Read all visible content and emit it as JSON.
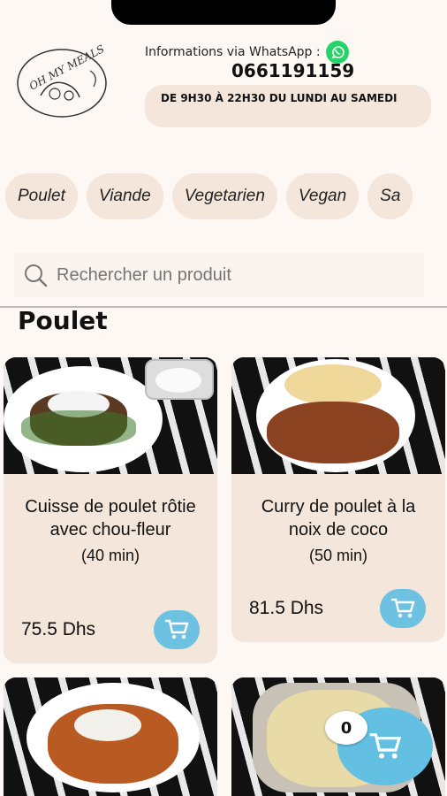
{
  "header": {
    "whatsapp_label": "Informations via WhatsApp :",
    "phone": "0661191159",
    "hours": "DE 9H30 À 22H30 DU LUNDI AU SAMEDI",
    "logo_text": "OH MY MEALS"
  },
  "categories": [
    "Poulet",
    "Viande",
    "Vegetarien",
    "Vegan",
    "Sa"
  ],
  "search": {
    "placeholder": "Rechercher un produit"
  },
  "section": {
    "title": "Poulet"
  },
  "products": [
    {
      "name": "Cuisse de poulet rôtie avec chou-fleur",
      "time": "(40 min)",
      "price": "75.5 Dhs"
    },
    {
      "name": "Curry de poulet à la noix de coco",
      "time": "(50 min)",
      "price": "81.5 Dhs"
    }
  ],
  "cart": {
    "count": "0"
  },
  "colors": {
    "accent": "#63c0e2",
    "chip": "#f4e6da",
    "whatsapp": "#25D366"
  }
}
